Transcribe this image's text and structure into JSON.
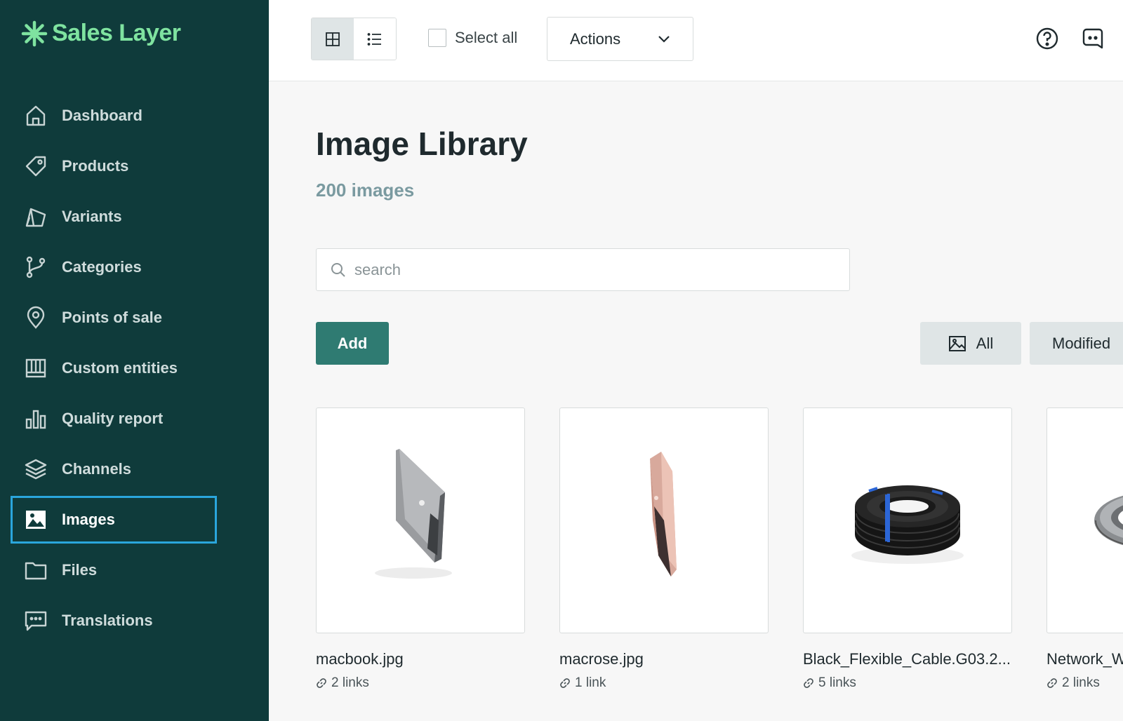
{
  "brand": {
    "name": "Sales Layer",
    "accent": "#7fe3a0",
    "sidebar_bg": "#0f3b3b"
  },
  "sidebar": {
    "items": [
      {
        "label": "Dashboard",
        "icon": "home-icon"
      },
      {
        "label": "Products",
        "icon": "tag-icon"
      },
      {
        "label": "Variants",
        "icon": "variants-icon"
      },
      {
        "label": "Categories",
        "icon": "branch-icon"
      },
      {
        "label": "Points of sale",
        "icon": "map-pin-icon"
      },
      {
        "label": "Custom entities",
        "icon": "custom-entities-icon"
      },
      {
        "label": "Quality report",
        "icon": "bar-chart-icon"
      },
      {
        "label": "Channels",
        "icon": "layers-icon"
      },
      {
        "label": "Images",
        "icon": "image-icon",
        "active": true
      },
      {
        "label": "Files",
        "icon": "folder-icon"
      },
      {
        "label": "Translations",
        "icon": "message-icon"
      }
    ]
  },
  "toolbar": {
    "view_modes": [
      "grid-icon",
      "list-icon"
    ],
    "active_view": "grid",
    "select_all_label": "Select all",
    "actions_label": "Actions"
  },
  "main": {
    "title": "Image Library",
    "count": "200 images",
    "search": {
      "placeholder": "search",
      "value": ""
    },
    "add_label": "Add",
    "filters": {
      "all_label": "All",
      "modified_label": "Modified"
    },
    "images": [
      {
        "name": "macbook.jpg",
        "links": "2 links",
        "thumb": "silver-laptop"
      },
      {
        "name": "macrose.jpg",
        "links": "1 link",
        "thumb": "rose-laptop"
      },
      {
        "name": "Black_Flexible_Cable.G03.2...",
        "links": "5 links",
        "thumb": "black-cable-coil"
      },
      {
        "name": "Network_W",
        "links": "2 links",
        "thumb": "grey-cable-coil"
      }
    ]
  }
}
